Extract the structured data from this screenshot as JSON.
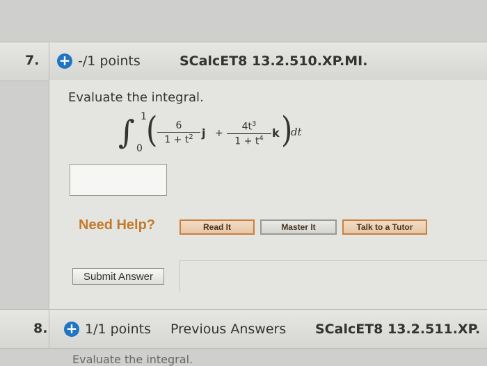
{
  "question7": {
    "number": "7.",
    "points": "-/1 points",
    "code": "SCalcET8 13.2.510.XP.MI.",
    "prompt": "Evaluate the integral.",
    "integral": {
      "upper": "1",
      "lower": "0",
      "term1_numerator": "6",
      "term1_denominator_base": "1 + t",
      "term1_denominator_exp": "2",
      "term1_vector": "j",
      "plus": "+",
      "term2_numerator_base": "4t",
      "term2_numerator_exp": "3",
      "term2_denominator_base": "1 + t",
      "term2_denominator_exp": "4",
      "term2_vector": "k",
      "differential": "dt"
    },
    "answer_value": "",
    "help_label": "Need Help?",
    "help_buttons": [
      "Read It",
      "Master It",
      "Talk to a Tutor"
    ],
    "submit_label": "Submit Answer"
  },
  "question8": {
    "number": "8.",
    "points": "1/1 points",
    "previous": "Previous Answers",
    "code": "SCalcET8 13.2.511.XP.",
    "prompt": "Evaluate the integral."
  },
  "colors": {
    "accent_blue": "#1f74c3",
    "help_orange": "#c47a2c"
  },
  "icons": {
    "plus": "plus-circle-icon"
  }
}
